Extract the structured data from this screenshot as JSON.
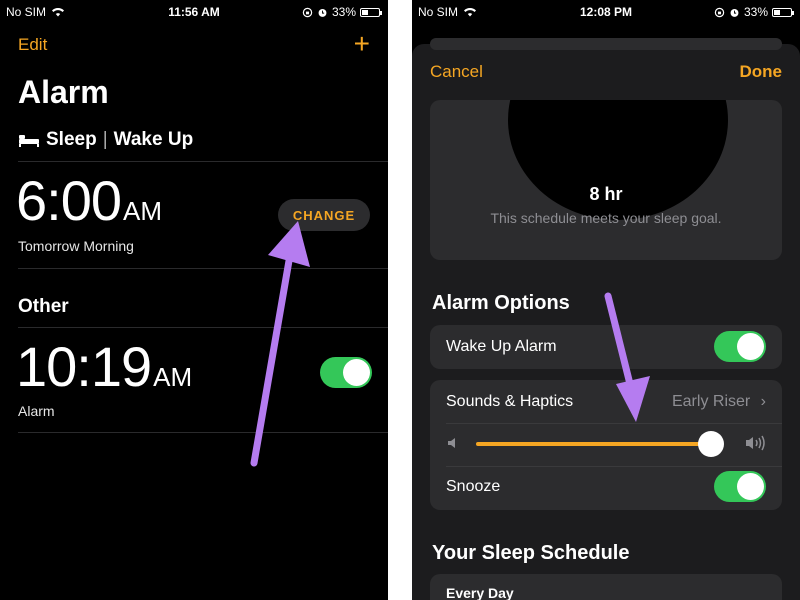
{
  "left": {
    "status": {
      "carrier": "No SIM",
      "time": "11:56 AM",
      "battery": "33%"
    },
    "nav": {
      "edit": "Edit",
      "add": "+"
    },
    "title": "Alarm",
    "sleep_header": {
      "sleep": "Sleep",
      "separator": "|",
      "wake": "Wake Up"
    },
    "sleep_alarm": {
      "time": "6:00",
      "ampm": "AM",
      "label": "Tomorrow Morning",
      "change_button": "CHANGE"
    },
    "other_heading": "Other",
    "other_alarm": {
      "time": "10:19",
      "ampm": "AM",
      "label": "Alarm",
      "enabled": true
    }
  },
  "right": {
    "status": {
      "carrier": "No SIM",
      "time": "12:08 PM",
      "battery": "33%"
    },
    "nav": {
      "cancel": "Cancel",
      "done": "Done"
    },
    "schedule_summary": {
      "duration": "8 hr",
      "message": "This schedule meets your sleep goal."
    },
    "alarm_options_heading": "Alarm Options",
    "wake_up_alarm": {
      "label": "Wake Up Alarm",
      "enabled": true
    },
    "sounds": {
      "label": "Sounds & Haptics",
      "value": "Early Riser",
      "chevron": "›"
    },
    "volume": {
      "level": 0.98
    },
    "snooze": {
      "label": "Snooze",
      "enabled": true
    },
    "sleep_schedule_heading": "Your Sleep Schedule",
    "schedule_row": {
      "label": "Every Day"
    }
  },
  "colors": {
    "accent": "#f5a623",
    "toggle_on": "#34c759",
    "annotation_arrow": "#b57cf0"
  }
}
